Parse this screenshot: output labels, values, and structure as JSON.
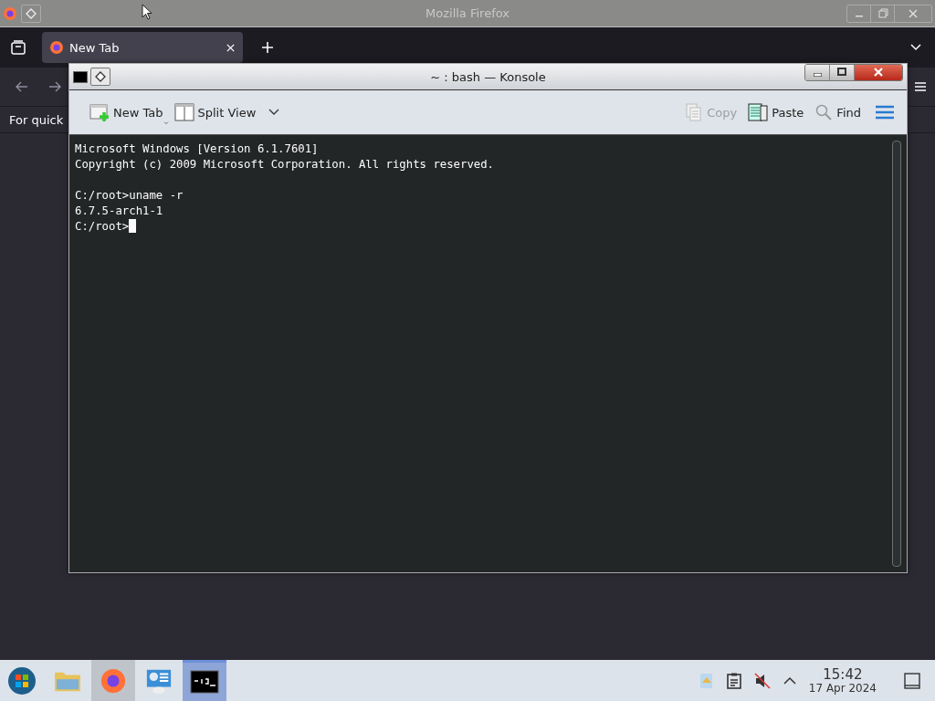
{
  "firefox": {
    "title": "Mozilla Firefox",
    "tabs": [
      {
        "label": "New Tab",
        "selected": true
      }
    ],
    "bookmarks_hint": "For quick"
  },
  "konsole": {
    "title": "~ : bash — Konsole",
    "toolbar": [
      {
        "kind": "new-tab",
        "label": "New Tab",
        "disabled": false
      },
      {
        "kind": "split-view",
        "label": "Split View",
        "disabled": false
      },
      {
        "kind": "copy",
        "label": "Copy",
        "disabled": true
      },
      {
        "kind": "paste",
        "label": "Paste",
        "disabled": false
      },
      {
        "kind": "find",
        "label": "Find",
        "disabled": false
      }
    ],
    "terminal": {
      "cursor": true,
      "blocks": [
        {
          "lines": [
            "Microsoft Windows [Version 6.1.7601]",
            "Copyright (c) 2009 Microsoft Corporation. All rights reserved."
          ]
        },
        {
          "lines": [
            "C:/root>uname -r",
            "6.7.5-arch1-1",
            "C:/root>"
          ]
        }
      ]
    }
  },
  "taskbar": {
    "items": [
      {
        "kind": "start",
        "selected": false,
        "hovered": false
      },
      {
        "kind": "files",
        "selected": false,
        "hovered": false
      },
      {
        "kind": "browser",
        "selected": false,
        "hovered": true
      },
      {
        "kind": "network",
        "selected": false,
        "hovered": false
      },
      {
        "kind": "terminal",
        "selected": true,
        "hovered": false
      }
    ],
    "clock": {
      "time": "15:42",
      "date": "17 Apr 2024"
    }
  }
}
